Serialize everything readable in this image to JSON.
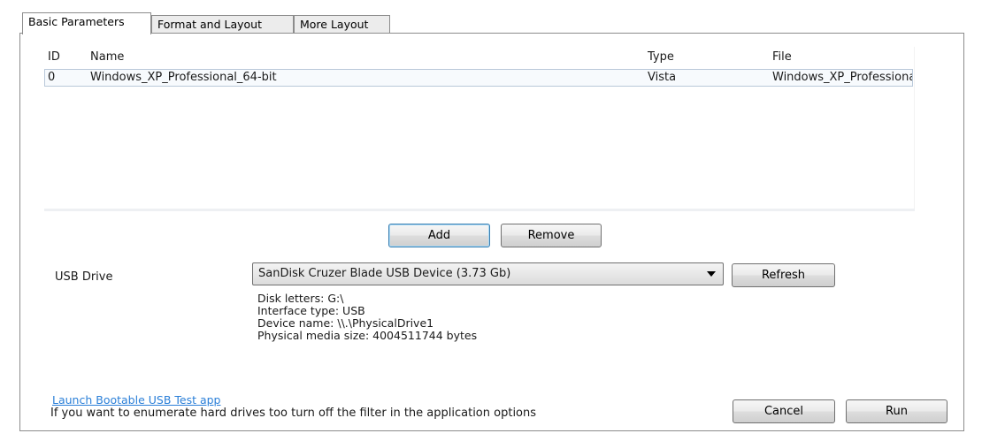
{
  "tabs": [
    {
      "label": "Basic Parameters"
    },
    {
      "label": "Format and Layout"
    },
    {
      "label": "More Layout"
    }
  ],
  "list": {
    "columns": [
      "ID",
      "Name",
      "Type",
      "File"
    ],
    "rows": [
      {
        "id": "0",
        "name": "Windows_XP_Professional_64-bit",
        "type": "Vista",
        "file": "Windows_XP_Professiona"
      }
    ]
  },
  "buttons": {
    "add": "Add",
    "remove": "Remove",
    "refresh": "Refresh",
    "cancel": "Cancel",
    "run": "Run"
  },
  "usb": {
    "label": "USB Drive",
    "selected": "SanDisk Cruzer Blade USB Device (3.73 Gb)",
    "disk_letters": "Disk letters: G:\\",
    "interface_type": "Interface type: USB",
    "device_name": "Device name: \\\\.\\PhysicalDrive1",
    "media_size": "Physical media size: 4004511744 bytes"
  },
  "footer": {
    "link": "Launch Bootable USB Test app",
    "hint": "If you want to enumerate hard drives too turn off the filter in the application options"
  }
}
